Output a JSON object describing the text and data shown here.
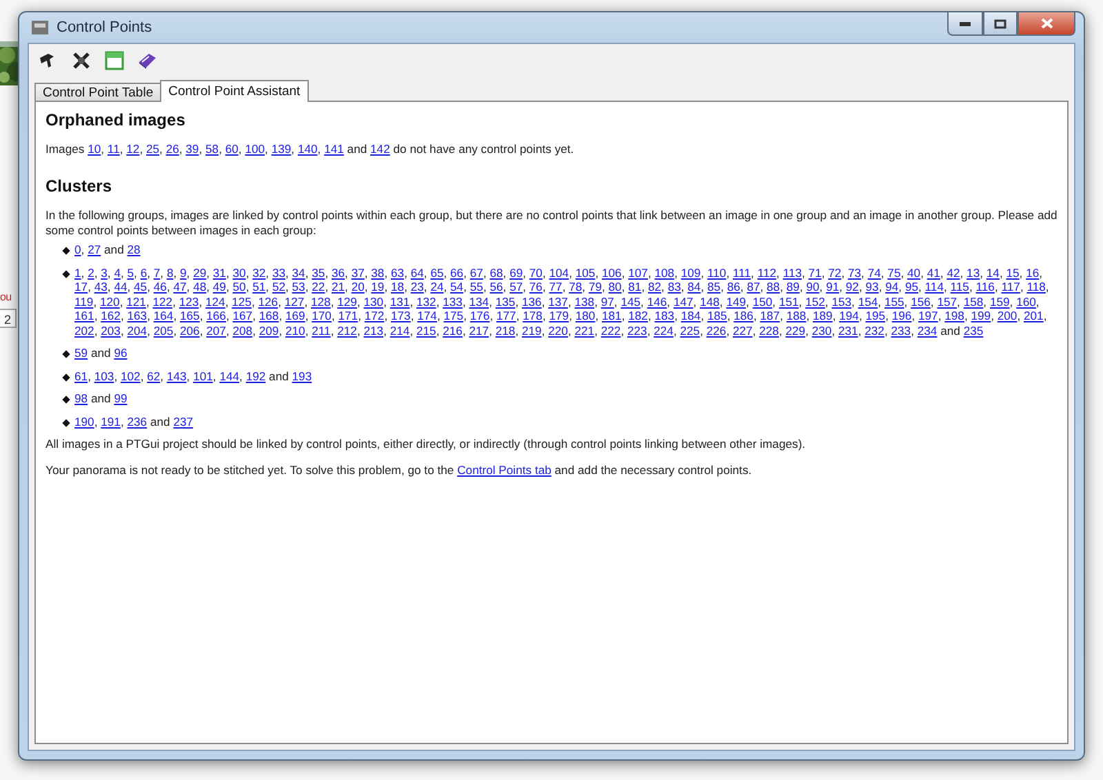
{
  "background_app": {
    "fragment": "ou",
    "field_value": "2"
  },
  "window": {
    "title": "Control Points"
  },
  "toolbar": [
    {
      "kind": "pin"
    },
    {
      "kind": "unpin"
    },
    {
      "kind": "window"
    },
    {
      "kind": "book"
    }
  ],
  "tabs": [
    {
      "label": "Control Point Table",
      "selected": false
    },
    {
      "label": "Control Point Assistant",
      "selected": true
    }
  ],
  "list_separator": ", ",
  "orphaned": {
    "heading": "Orphaned images",
    "prefix": "Images",
    "images": [
      "10",
      "11",
      "12",
      "25",
      "26",
      "39",
      "58",
      "60",
      "100",
      "139",
      "140",
      "141",
      "142"
    ],
    "joiner": "and",
    "suffix": "do not have any control points yet."
  },
  "clusters": {
    "heading": "Clusters",
    "intro": "In the following groups, images are linked by control points within each group, but there are no control points that link between an image in one group and an image in another group. Please add some control points between images in each group:",
    "groups": [
      {
        "images": [
          "0",
          "27",
          "28"
        ],
        "joiner": "and"
      },
      {
        "images": [
          "1",
          "2",
          "3",
          "4",
          "5",
          "6",
          "7",
          "8",
          "9",
          "29",
          "31",
          "30",
          "32",
          "33",
          "34",
          "35",
          "36",
          "37",
          "38",
          "63",
          "64",
          "65",
          "66",
          "67",
          "68",
          "69",
          "70",
          "104",
          "105",
          "106",
          "107",
          "108",
          "109",
          "110",
          "111",
          "112",
          "113",
          "71",
          "72",
          "73",
          "74",
          "75",
          "40",
          "41",
          "42",
          "13",
          "14",
          "15",
          "16",
          "17",
          "43",
          "44",
          "45",
          "46",
          "47",
          "48",
          "49",
          "50",
          "51",
          "52",
          "53",
          "22",
          "21",
          "20",
          "19",
          "18",
          "23",
          "24",
          "54",
          "55",
          "56",
          "57",
          "76",
          "77",
          "78",
          "79",
          "80",
          "81",
          "82",
          "83",
          "84",
          "85",
          "86",
          "87",
          "88",
          "89",
          "90",
          "91",
          "92",
          "93",
          "94",
          "95",
          "114",
          "115",
          "116",
          "117",
          "118",
          "119",
          "120",
          "121",
          "122",
          "123",
          "124",
          "125",
          "126",
          "127",
          "128",
          "129",
          "130",
          "131",
          "132",
          "133",
          "134",
          "135",
          "136",
          "137",
          "138",
          "97",
          "145",
          "146",
          "147",
          "148",
          "149",
          "150",
          "151",
          "152",
          "153",
          "154",
          "155",
          "156",
          "157",
          "158",
          "159",
          "160",
          "161",
          "162",
          "163",
          "164",
          "165",
          "166",
          "167",
          "168",
          "169",
          "170",
          "171",
          "172",
          "173",
          "174",
          "175",
          "176",
          "177",
          "178",
          "179",
          "180",
          "181",
          "182",
          "183",
          "184",
          "185",
          "186",
          "187",
          "188",
          "189",
          "194",
          "195",
          "196",
          "197",
          "198",
          "199",
          "200",
          "201",
          "202",
          "203",
          "204",
          "205",
          "206",
          "207",
          "208",
          "209",
          "210",
          "211",
          "212",
          "213",
          "214",
          "215",
          "216",
          "217",
          "218",
          "219",
          "220",
          "221",
          "222",
          "223",
          "224",
          "225",
          "226",
          "227",
          "228",
          "229",
          "230",
          "231",
          "232",
          "233",
          "234",
          "235"
        ],
        "joiner": "and"
      },
      {
        "images": [
          "59",
          "96"
        ],
        "joiner": "and"
      },
      {
        "images": [
          "61",
          "103",
          "102",
          "62",
          "143",
          "101",
          "144",
          "192",
          "193"
        ],
        "joiner": "and"
      },
      {
        "images": [
          "98",
          "99"
        ],
        "joiner": "and"
      },
      {
        "images": [
          "190",
          "191",
          "236",
          "237"
        ],
        "joiner": "and"
      }
    ],
    "note": "All images in a PTGui project should be linked by control points, either directly, or indirectly (through control points linking between other images)."
  },
  "status": {
    "before": "Your panorama is not ready to be stitched yet. To solve this problem, go to the",
    "link": "Control Points tab",
    "after": "and add the necessary control points."
  }
}
